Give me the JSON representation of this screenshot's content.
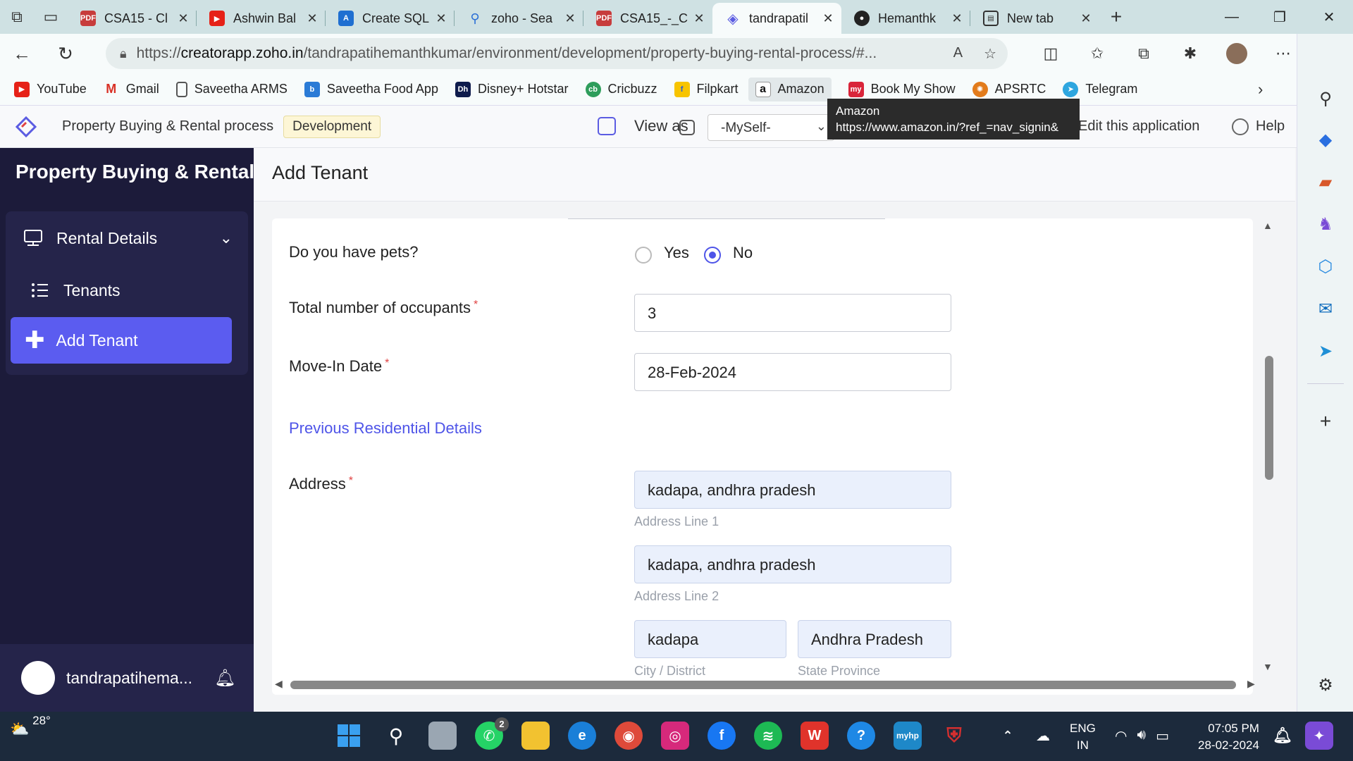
{
  "browser": {
    "tabs": [
      {
        "title": "CSA15 - Cl",
        "icon": "pdf-icon",
        "color": "#c73c3c"
      },
      {
        "title": "Ashwin Bal",
        "icon": "youtube-icon",
        "color": "#e62117"
      },
      {
        "title": "Create SQL",
        "icon": "azure-icon",
        "color": "#1f6fd1"
      },
      {
        "title": "zoho - Sea",
        "icon": "search-icon",
        "color": "#2b6fd6"
      },
      {
        "title": "CSA15_-_C",
        "icon": "pdf-icon",
        "color": "#c73c3c"
      },
      {
        "title": "tandrapatil",
        "icon": "zoho-creator-icon",
        "color": "#5b5ce2",
        "active": true
      },
      {
        "title": "Hemanthk",
        "icon": "github-icon",
        "color": "#222222"
      },
      {
        "title": "New tab",
        "icon": "newtab-icon",
        "color": "#333333"
      }
    ],
    "url_prefix": "https://",
    "url_host": "creatorapp.zoho.in",
    "url_path": "/tandrapatihemanthkumar/environment/development/property-buying-rental-process/#...",
    "bookmarks": [
      {
        "label": "YouTube",
        "icon": "youtube-icon",
        "color": "#e62117"
      },
      {
        "label": "Gmail",
        "icon": "gmail-icon",
        "color": "#d93025"
      },
      {
        "label": "Saveetha ARMS",
        "icon": "document-icon",
        "color": "#666666"
      },
      {
        "label": "Saveetha Food App",
        "icon": "food-app-icon",
        "color": "#2b7bd6"
      },
      {
        "label": "Disney+ Hotstar",
        "icon": "hotstar-icon",
        "color": "#0f1b4c"
      },
      {
        "label": "Cricbuzz",
        "icon": "cricbuzz-icon",
        "color": "#2e9d5b"
      },
      {
        "label": "Filpkart",
        "icon": "flipkart-icon",
        "color": "#f7c400"
      },
      {
        "label": "Amazon",
        "icon": "amazon-icon",
        "color": "#111111"
      },
      {
        "label": "Book My Show",
        "icon": "bookmyshow-icon",
        "color": "#d9253a"
      },
      {
        "label": "APSRTC",
        "icon": "apsrtc-icon",
        "color": "#e27b1b"
      },
      {
        "label": "Telegram",
        "icon": "telegram-icon",
        "color": "#2ea6df"
      }
    ],
    "tooltip": {
      "title": "Amazon",
      "url": "https://www.amazon.in/?ref_=nav_signin&"
    }
  },
  "app": {
    "name": "Property Buying & Rental process",
    "environment": "Development",
    "view_as": "View as",
    "view_as_value": "-MySelf-",
    "edit_app": "Edit this application",
    "help": "Help",
    "accent": "#5b5cf0"
  },
  "sidebar": {
    "title": "Property Buying & Rental",
    "section": "Rental Details",
    "items": [
      {
        "label": "Tenants",
        "icon": "list-icon"
      },
      {
        "label": "Add Tenant",
        "icon": "add-icon",
        "active": true
      }
    ],
    "user": "tandrapatihema..."
  },
  "page": {
    "title": "Add Tenant"
  },
  "form": {
    "pets": {
      "label": "Do you have pets?",
      "options": [
        "Yes",
        "No"
      ],
      "selected": "No"
    },
    "occupants": {
      "label": "Total number of occupants",
      "required": "*",
      "value": "3"
    },
    "move_in": {
      "label": "Move-In Date",
      "required": "*",
      "value": "28-Feb-2024"
    },
    "section": "Previous Residential Details",
    "address": {
      "label": "Address",
      "required": "*",
      "line1": {
        "value": "kadapa, andhra pradesh",
        "hint": "Address Line 1"
      },
      "line2": {
        "value": "kadapa, andhra pradesh",
        "hint": "Address Line 2"
      },
      "city": {
        "value": "kadapa",
        "hint": "City / District"
      },
      "state": {
        "value": "Andhra Pradesh",
        "hint": "State Province"
      }
    }
  },
  "taskbar": {
    "weather": "28°",
    "whatsapp_badge": "2",
    "lang_1": "ENG",
    "lang_2": "IN",
    "time": "07:05 PM",
    "date": "28-02-2024"
  }
}
